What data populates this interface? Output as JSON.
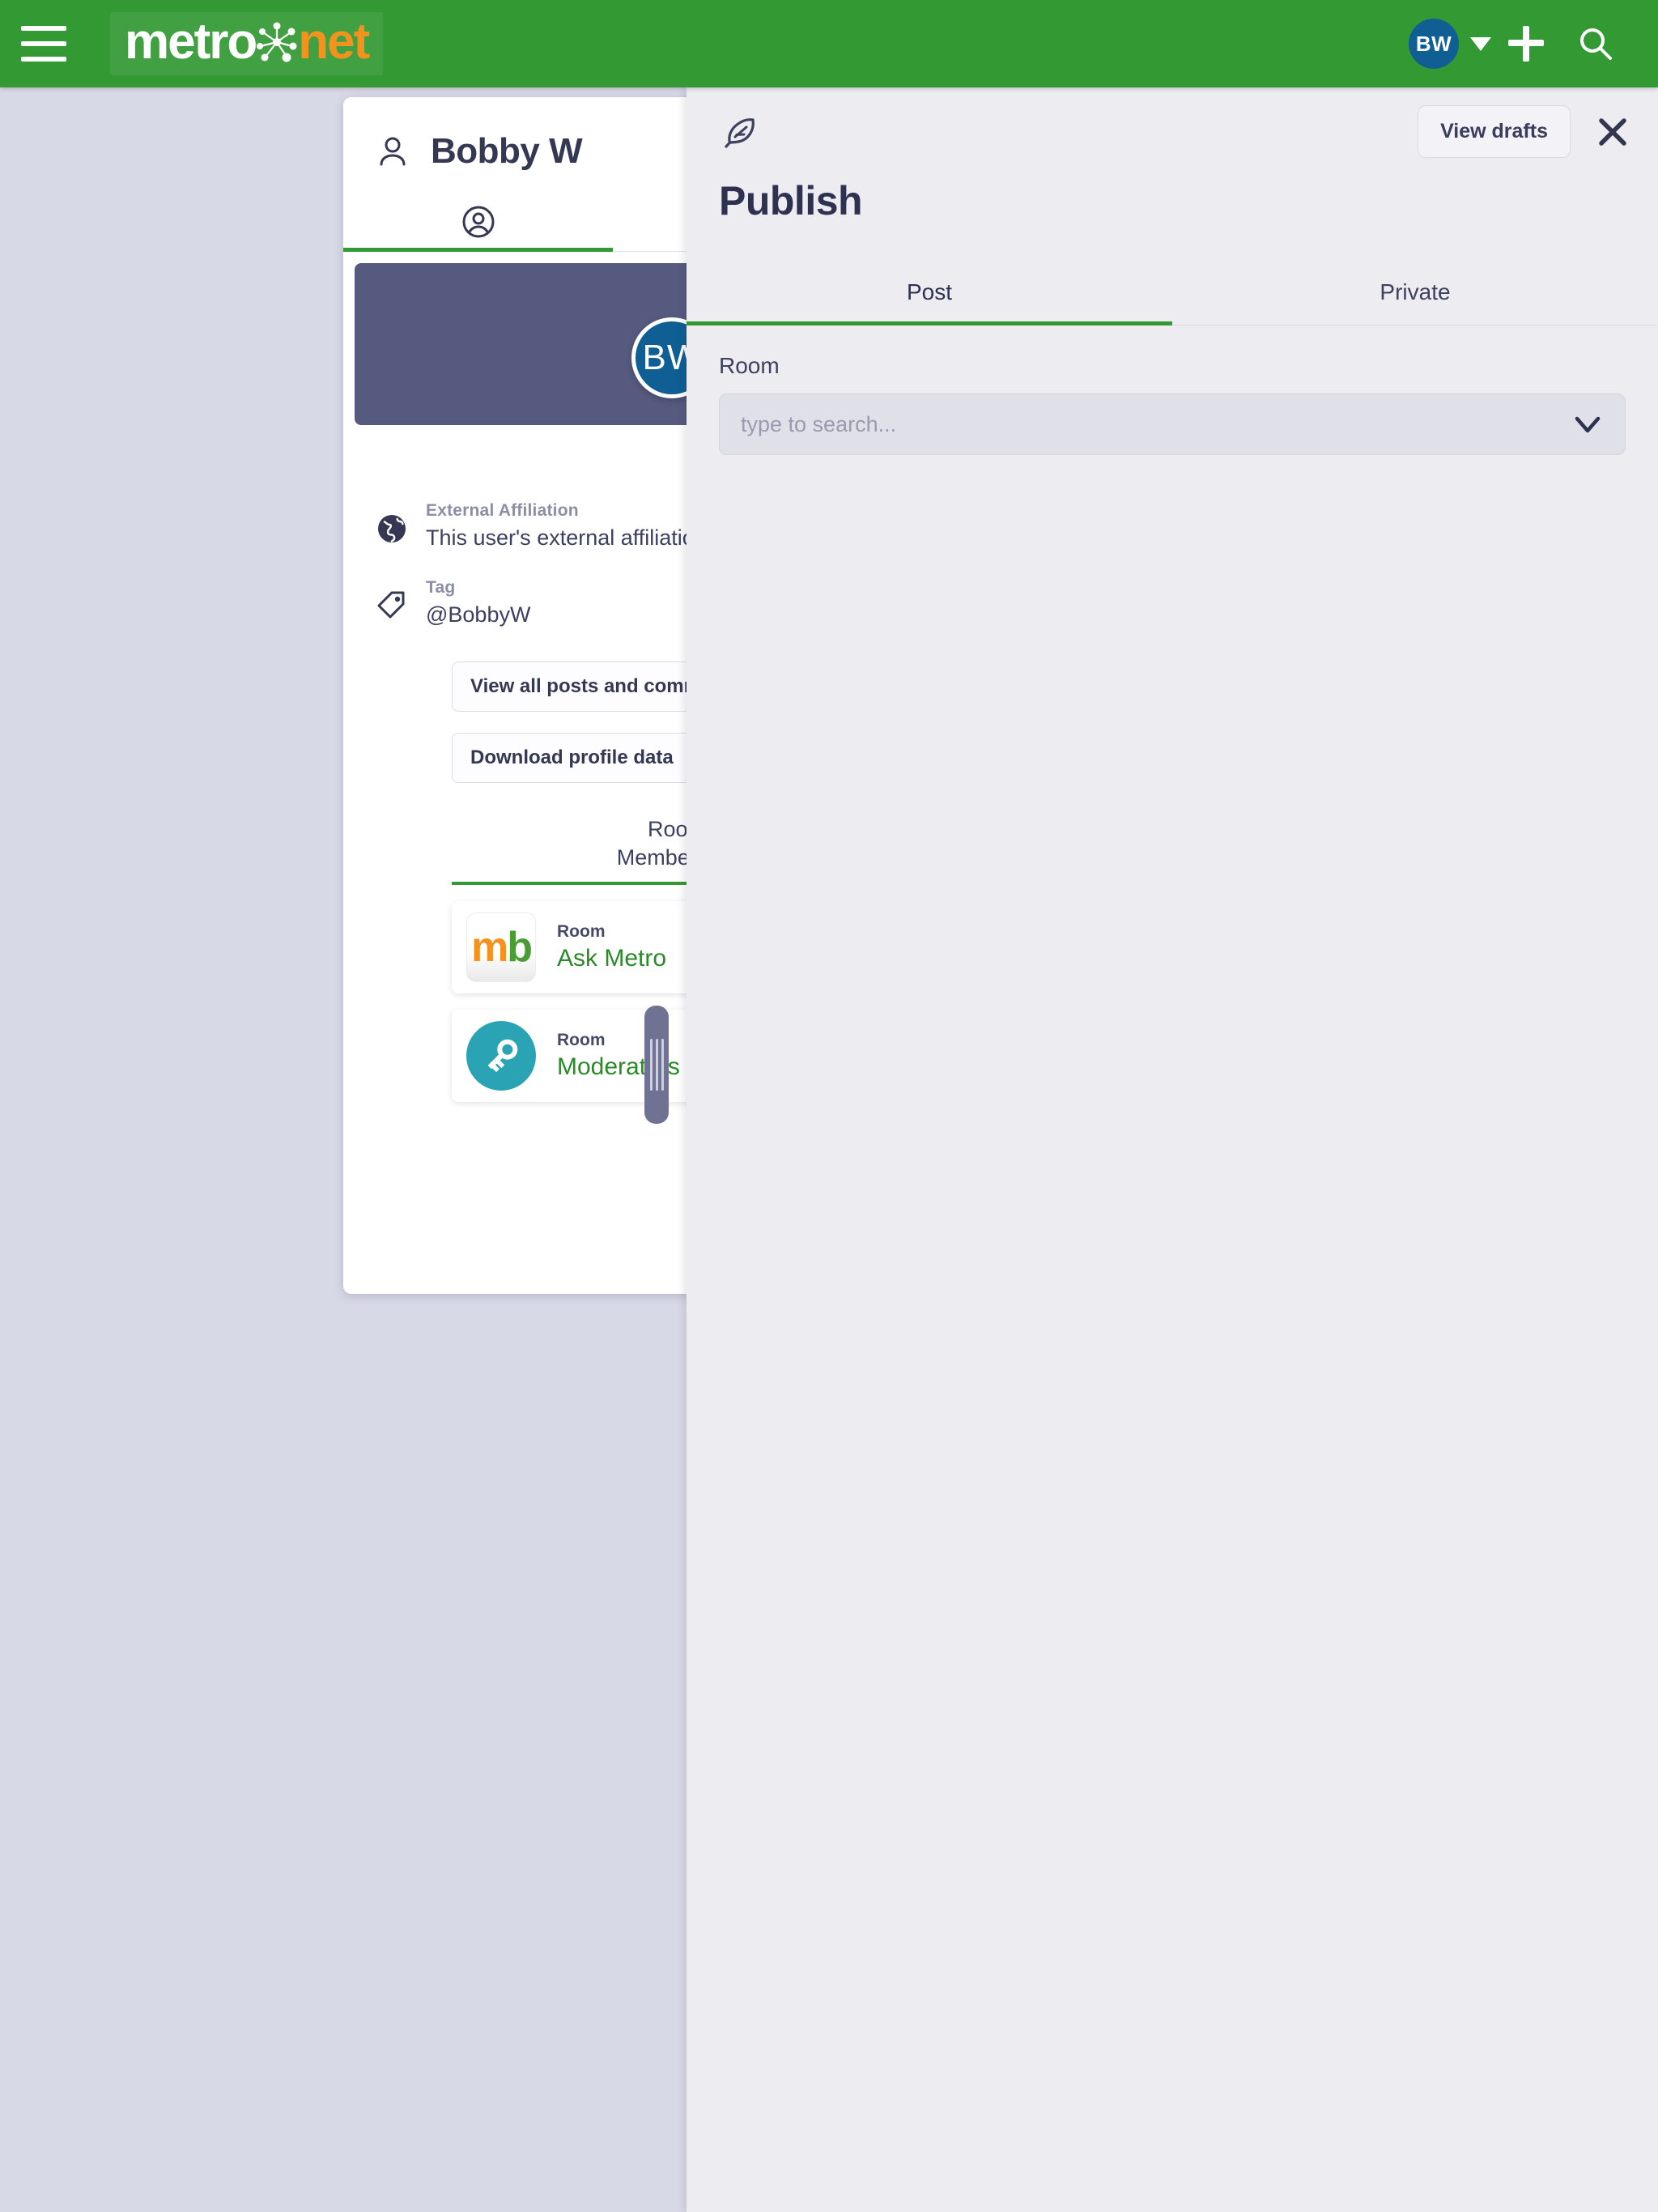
{
  "app": {
    "brand_part1": "metro",
    "brand_part2": "net",
    "brand_icon": "network-node-icon",
    "menu_icon": "hamburger-menu-icon",
    "accent_green": "#339933",
    "brand_orange": "#f4921e"
  },
  "topbar": {
    "user_initials": "BW",
    "user_menu_icon": "chevron-down-icon",
    "add_icon": "plus-icon",
    "search_icon": "search-icon"
  },
  "profile": {
    "header_icon": "user-icon",
    "name": "Bobby W",
    "tabs": [
      {
        "icon": "profile-circle-icon",
        "active": true
      },
      {
        "icon": "home-icon",
        "active": false
      }
    ],
    "avatar_initials": "BW",
    "fields": [
      {
        "icon": "globe-icon",
        "label": "External Affiliation",
        "value": "This user's external affiliation"
      },
      {
        "icon": "tag-icon",
        "label": "Tag",
        "value": "@BobbyW"
      }
    ],
    "buttons": [
      {
        "label": "View all posts and comments"
      },
      {
        "label": "Download profile data"
      }
    ],
    "membership": {
      "title_line1": "Room",
      "title_line2": "Membership",
      "rooms": [
        {
          "logo": "mb-logo-icon",
          "logo_text_1": "m",
          "logo_text_2": "b",
          "meta_label": "Room",
          "name": "Ask Metro"
        },
        {
          "logo": "key-icon",
          "meta_label": "Room",
          "name": "Moderators"
        }
      ]
    },
    "scrollbar": {
      "name": "drag-handle"
    }
  },
  "publish": {
    "icon": "quill-feather-icon",
    "title": "Publish",
    "view_drafts_label": "View drafts",
    "close_icon": "close-icon",
    "tabs": [
      {
        "label": "Post",
        "active": true
      },
      {
        "label": "Private",
        "active": false
      }
    ],
    "room_field": {
      "label": "Room",
      "placeholder": "type to search...",
      "value": "",
      "dropdown_icon": "chevron-down-icon"
    }
  }
}
